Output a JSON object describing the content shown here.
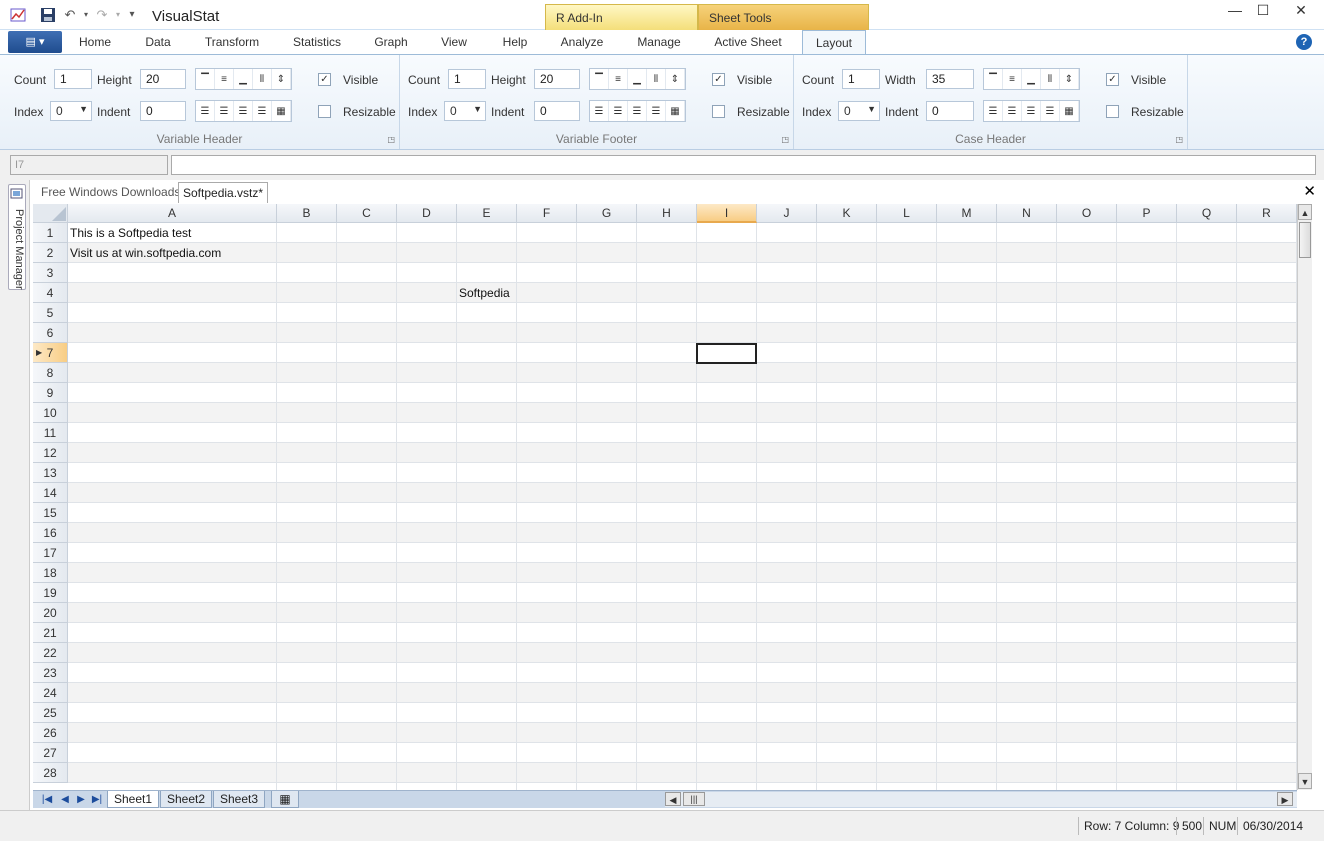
{
  "app": {
    "title": "VisualStat"
  },
  "context_groups": [
    {
      "label": "R Add-In"
    },
    {
      "label": "Sheet Tools"
    }
  ],
  "file_button": {
    "label": "▤ ▾"
  },
  "ribbon_tabs": [
    {
      "label": "Home"
    },
    {
      "label": "Data"
    },
    {
      "label": "Transform"
    },
    {
      "label": "Statistics"
    },
    {
      "label": "Graph"
    },
    {
      "label": "View"
    },
    {
      "label": "Help"
    },
    {
      "label": "Analyze"
    },
    {
      "label": "Manage"
    },
    {
      "label": "Active Sheet"
    },
    {
      "label": "Layout",
      "active": true
    }
  ],
  "ribbon": {
    "variable_header": {
      "caption": "Variable Header",
      "count_label": "Count",
      "count_value": "1",
      "size_label": "Height",
      "size_value": "20",
      "index_label": "Index",
      "index_value": "0",
      "indent_label": "Indent",
      "indent_value": "0",
      "visible_label": "Visible",
      "visible_checked": true,
      "resizable_label": "Resizable",
      "resizable_checked": false
    },
    "variable_footer": {
      "caption": "Variable Footer",
      "count_label": "Count",
      "count_value": "1",
      "size_label": "Height",
      "size_value": "20",
      "index_label": "Index",
      "index_value": "0",
      "indent_label": "Indent",
      "indent_value": "0",
      "visible_label": "Visible",
      "visible_checked": true,
      "resizable_label": "Resizable",
      "resizable_checked": false
    },
    "case_header": {
      "caption": "Case Header",
      "count_label": "Count",
      "count_value": "1",
      "size_label": "Width",
      "size_value": "35",
      "index_label": "Index",
      "index_value": "0",
      "indent_label": "Indent",
      "indent_value": "0",
      "visible_label": "Visible",
      "visible_checked": true,
      "resizable_label": "Resizable",
      "resizable_checked": false
    }
  },
  "formula_bar": {
    "name_box": "I7",
    "formula": ""
  },
  "side_panel": {
    "label": "Project Manager"
  },
  "doc_tabs": [
    {
      "label": "Free Windows Downloads"
    },
    {
      "label": "Softpedia.vstz*",
      "active": true
    }
  ],
  "spreadsheet": {
    "columns": [
      "A",
      "B",
      "C",
      "D",
      "E",
      "F",
      "G",
      "H",
      "I",
      "J",
      "K",
      "L",
      "M",
      "N",
      "O",
      "P",
      "Q",
      "R"
    ],
    "selected_column": "I",
    "rows": [
      "1",
      "2",
      "3",
      "4",
      "5",
      "6",
      "7",
      "8",
      "9",
      "10",
      "11",
      "12",
      "13",
      "14",
      "15",
      "16",
      "17",
      "18",
      "19",
      "20",
      "21",
      "22",
      "23",
      "24",
      "25",
      "26",
      "27",
      "28"
    ],
    "selected_row": "7",
    "cells": [
      {
        "row": 1,
        "col": "A",
        "value": "This is a Softpedia test"
      },
      {
        "row": 2,
        "col": "A",
        "value": "Visit us at win.softpedia.com"
      },
      {
        "row": 4,
        "col": "E",
        "value": "Softpedia"
      }
    ]
  },
  "sheet_tabs": [
    {
      "label": "Sheet1",
      "active": true
    },
    {
      "label": "Sheet2"
    },
    {
      "label": "Sheet3"
    }
  ],
  "status": {
    "position": "Row: 7 Column: 9",
    "count": "500",
    "mode": "NUM",
    "date": "06/30/2014"
  },
  "icons": {
    "save": "save-icon",
    "undo": "undo-icon",
    "redo": "redo-icon",
    "help": "help-icon"
  }
}
